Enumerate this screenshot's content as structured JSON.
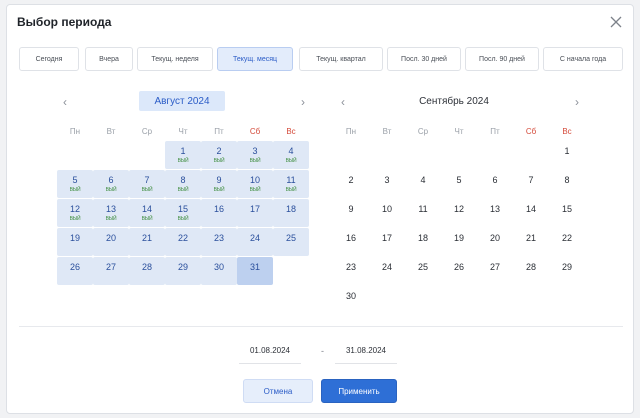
{
  "dialog": {
    "title": "Выбор периода"
  },
  "tabs": [
    {
      "label": "Сегодня",
      "active": false
    },
    {
      "label": "Вчера",
      "active": false
    },
    {
      "label": "Текущ. неделя",
      "active": false
    },
    {
      "label": "Текущ. месяц",
      "active": true
    },
    {
      "label": "Текущ. квартал",
      "active": false
    },
    {
      "label": "Посл. 30 дней",
      "active": false
    },
    {
      "label": "Посл. 90 дней",
      "active": false
    },
    {
      "label": "С начала года",
      "active": false
    }
  ],
  "weekdays": [
    "Пн",
    "Вт",
    "Ср",
    "Чт",
    "Пт",
    "Сб",
    "Вс"
  ],
  "calendar_left": {
    "month": "Август 2024",
    "weeks": [
      [
        null,
        null,
        null,
        {
          "d": "1",
          "s": "ВЫЙ",
          "range": true
        },
        {
          "d": "2",
          "s": "ВЫЙ",
          "range": true
        },
        {
          "d": "3",
          "s": "ВЫЙ",
          "range": true
        },
        {
          "d": "4",
          "s": "ВЫЙ",
          "range": true
        }
      ],
      [
        {
          "d": "5",
          "s": "ВЫЙ",
          "range": true
        },
        {
          "d": "6",
          "s": "ВЫЙ",
          "range": true
        },
        {
          "d": "7",
          "s": "ВЫЙ",
          "range": true
        },
        {
          "d": "8",
          "s": "ВЫЙ",
          "range": true
        },
        {
          "d": "9",
          "s": "ВЫЙ",
          "range": true
        },
        {
          "d": "10",
          "s": "ВЫЙ",
          "range": true
        },
        {
          "d": "11",
          "s": "ВЫЙ",
          "range": true
        }
      ],
      [
        {
          "d": "12",
          "s": "ВЫЙ",
          "range": true
        },
        {
          "d": "13",
          "s": "ВЫЙ",
          "range": true
        },
        {
          "d": "14",
          "s": "ВЫЙ",
          "range": true
        },
        {
          "d": "15",
          "s": "ВЫЙ",
          "range": true
        },
        {
          "d": "16",
          "s": "",
          "range": true
        },
        {
          "d": "17",
          "s": "",
          "range": true
        },
        {
          "d": "18",
          "s": "",
          "range": true
        }
      ],
      [
        {
          "d": "19",
          "s": "",
          "range": true
        },
        {
          "d": "20",
          "s": "",
          "range": true
        },
        {
          "d": "21",
          "s": "",
          "range": true
        },
        {
          "d": "22",
          "s": "",
          "range": true
        },
        {
          "d": "23",
          "s": "",
          "range": true
        },
        {
          "d": "24",
          "s": "",
          "range": true
        },
        {
          "d": "25",
          "s": "",
          "range": true
        }
      ],
      [
        {
          "d": "26",
          "s": "",
          "range": true
        },
        {
          "d": "27",
          "s": "",
          "range": true
        },
        {
          "d": "28",
          "s": "",
          "range": true
        },
        {
          "d": "29",
          "s": "",
          "range": true
        },
        {
          "d": "30",
          "s": "",
          "range": true
        },
        {
          "d": "31",
          "s": "",
          "range": true,
          "sel": true
        },
        null
      ]
    ]
  },
  "calendar_right": {
    "month": "Сентябрь 2024",
    "weeks": [
      [
        null,
        null,
        null,
        null,
        null,
        null,
        {
          "d": "1",
          "s": ""
        }
      ],
      [
        {
          "d": "2",
          "s": ""
        },
        {
          "d": "3",
          "s": ""
        },
        {
          "d": "4",
          "s": ""
        },
        {
          "d": "5",
          "s": ""
        },
        {
          "d": "6",
          "s": ""
        },
        {
          "d": "7",
          "s": ""
        },
        {
          "d": "8",
          "s": ""
        }
      ],
      [
        {
          "d": "9",
          "s": ""
        },
        {
          "d": "10",
          "s": ""
        },
        {
          "d": "11",
          "s": ""
        },
        {
          "d": "12",
          "s": ""
        },
        {
          "d": "13",
          "s": ""
        },
        {
          "d": "14",
          "s": ""
        },
        {
          "d": "15",
          "s": ""
        }
      ],
      [
        {
          "d": "16",
          "s": ""
        },
        {
          "d": "17",
          "s": ""
        },
        {
          "d": "18",
          "s": ""
        },
        {
          "d": "19",
          "s": ""
        },
        {
          "d": "20",
          "s": ""
        },
        {
          "d": "21",
          "s": ""
        },
        {
          "d": "22",
          "s": ""
        }
      ],
      [
        {
          "d": "23",
          "s": ""
        },
        {
          "d": "24",
          "s": ""
        },
        {
          "d": "25",
          "s": ""
        },
        {
          "d": "26",
          "s": ""
        },
        {
          "d": "27",
          "s": ""
        },
        {
          "d": "28",
          "s": ""
        },
        {
          "d": "29",
          "s": ""
        }
      ],
      [
        {
          "d": "30",
          "s": ""
        },
        null,
        null,
        null,
        null,
        null,
        null
      ]
    ]
  },
  "range": {
    "from": "01.08.2024",
    "to": "31.08.2024",
    "separator": "-"
  },
  "footer": {
    "cancel_label": "Отмена",
    "apply_label": "Применить"
  },
  "colors": {
    "accent": "#2e6fd6",
    "range_bg": "#dfe8f6",
    "weekend": "#d44a3a",
    "holiday_note": "#3a8a3a"
  },
  "icons": {
    "close": "close-icon",
    "prev": "chevron-left-icon",
    "next": "chevron-right-icon"
  }
}
